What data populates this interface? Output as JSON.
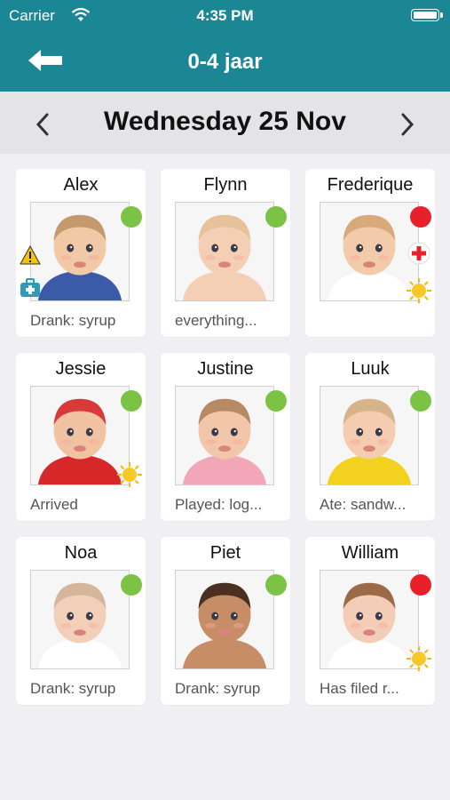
{
  "status_bar": {
    "carrier": "Carrier",
    "time": "4:35 PM"
  },
  "header": {
    "title": "0-4 jaar",
    "back_icon": "back-arrow-icon"
  },
  "date_nav": {
    "label": "Wednesday 25 Nov",
    "prev_icon": "chevron-left-icon",
    "next_icon": "chevron-right-icon"
  },
  "colors": {
    "header": "#1b8694",
    "present": "#7cc245",
    "absent": "#e8202a",
    "background": "#efeff4"
  },
  "children": [
    {
      "name": "Alex",
      "status": "Drank: syrup",
      "presence": "green",
      "icons": [
        "warning-icon",
        "first-aid-kit-icon"
      ],
      "skin": "#f2c9a7",
      "hair": "#c49a6c",
      "shirt": "#3b5aa8"
    },
    {
      "name": "Flynn",
      "status": "everything...",
      "presence": "green",
      "icons": [],
      "skin": "#f5cfb4",
      "hair": "#e6c29a",
      "shirt": "#f5cfb4"
    },
    {
      "name": "Frederique",
      "status": "",
      "presence": "red",
      "icons": [
        "medical-cross-icon",
        "sun-icon"
      ],
      "skin": "#f4cbaa",
      "hair": "#d9a97a",
      "shirt": "#ffffff"
    },
    {
      "name": "Jessie",
      "status": "Arrived",
      "presence": "green",
      "icons": [
        "sun-icon"
      ],
      "skin": "#f1c3a2",
      "hair": "#d83a3a",
      "shirt": "#d62828"
    },
    {
      "name": "Justine",
      "status": "Played: log...",
      "presence": "green",
      "icons": [],
      "skin": "#f2c6a8",
      "hair": "#b78a63",
      "shirt": "#f2a7b8"
    },
    {
      "name": "Luuk",
      "status": "Ate: sandw...",
      "presence": "green",
      "icons": [],
      "skin": "#f4cdb0",
      "hair": "#d7b38b",
      "shirt": "#f2d21e"
    },
    {
      "name": "Noa",
      "status": "Drank: syrup",
      "presence": "green",
      "icons": [],
      "skin": "#f3cfb8",
      "hair": "#d5b69a",
      "shirt": "#ffffff"
    },
    {
      "name": "Piet",
      "status": "Drank: syrup",
      "presence": "green",
      "icons": [],
      "skin": "#c78d66",
      "hair": "#4a3020",
      "shirt": "#c78d66"
    },
    {
      "name": "William",
      "status": "Has filed r...",
      "presence": "red",
      "icons": [
        "sun-icon"
      ],
      "skin": "#f3cdb6",
      "hair": "#9c6a47",
      "shirt": "#ffffff"
    }
  ]
}
